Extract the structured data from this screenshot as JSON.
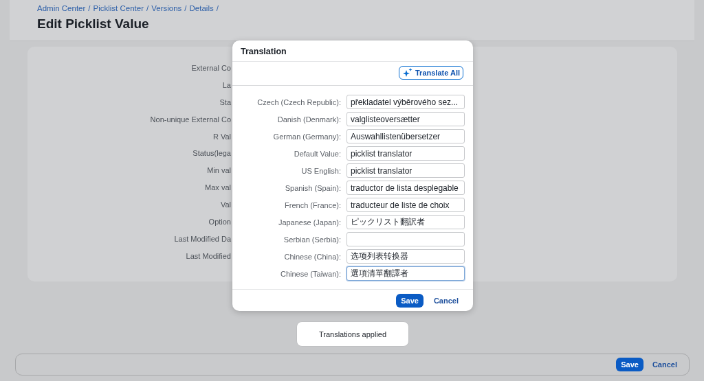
{
  "breadcrumbs": [
    "Admin Center",
    "Picklist Center",
    "Versions",
    "Details"
  ],
  "breadcrumb_separator": "/",
  "page_title": "Edit Picklist Value",
  "form_labels": [
    "External Co",
    "La",
    "Sta",
    "Non-unique External Co",
    "R Val",
    "Status(lega",
    "Min val",
    "Max val",
    "Val",
    "Option",
    "Last Modified Da",
    "Last Modified"
  ],
  "dialog": {
    "title": "Translation",
    "translate_all_button": "Translate All",
    "rows": [
      {
        "label": "Czech (Czech Republic):",
        "value": "překladatel výběrového sez...",
        "focused": false
      },
      {
        "label": "Danish (Denmark):",
        "value": "valglisteoversætter",
        "focused": false
      },
      {
        "label": "German (Germany):",
        "value": "Auswahllistenübersetzer",
        "focused": false
      },
      {
        "label": "Default Value:",
        "value": "picklist translator",
        "focused": false
      },
      {
        "label": "US English:",
        "value": "picklist translator",
        "focused": false
      },
      {
        "label": "Spanish (Spain):",
        "value": "traductor de lista desplegable",
        "focused": false
      },
      {
        "label": "French (France):",
        "value": "traducteur de liste de choix",
        "focused": false
      },
      {
        "label": "Japanese (Japan):",
        "value": "ピックリスト翻訳者",
        "focused": false
      },
      {
        "label": "Serbian (Serbia):",
        "focused": false
      },
      {
        "label": "Chinese (China):",
        "value": "选项列表转换器",
        "focused": false
      },
      {
        "label": "Chinese (Taiwan):",
        "value": "選項清單翻譯者",
        "focused": true
      }
    ],
    "buttons": [
      {
        "label": "Save",
        "kind": "primary"
      },
      {
        "label": "Cancel",
        "kind": "transparent"
      }
    ]
  },
  "toast": "Translations applied",
  "footer_buttons": [
    {
      "label": "Save",
      "kind": "primary"
    },
    {
      "label": "Cancel",
      "kind": "transparent"
    }
  ]
}
